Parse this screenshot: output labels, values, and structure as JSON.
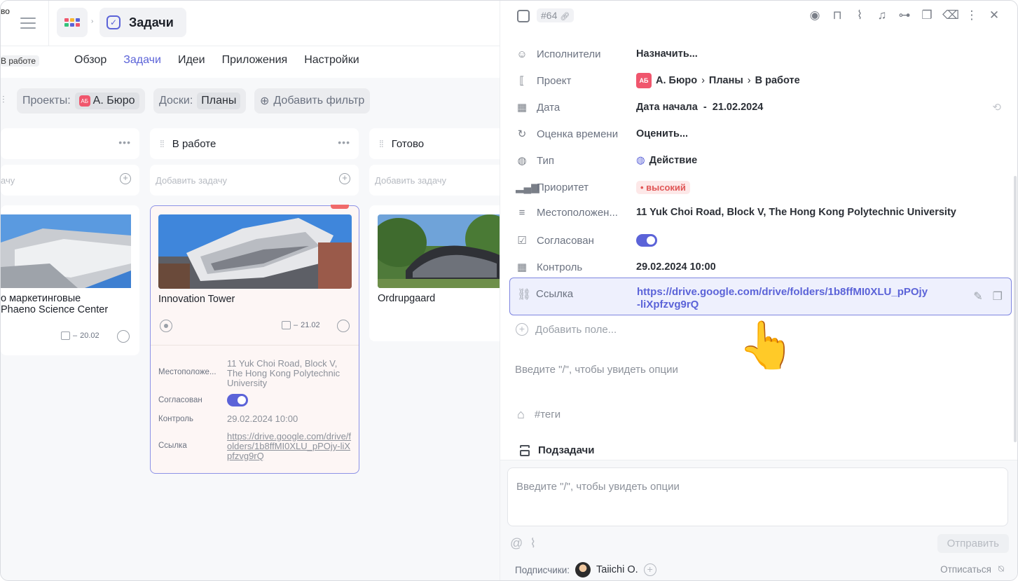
{
  "topbar": {
    "corner_text": "во",
    "section_title": "Задачи",
    "status_chip": "В работе"
  },
  "nav": {
    "tabs": [
      "Обзор",
      "Задачи",
      "Идеи",
      "Приложения",
      "Настройки"
    ],
    "active": "Задачи"
  },
  "filters": {
    "projects_label": "Проекты:",
    "projects_value": "А. Бюро",
    "projects_badge": "АБ",
    "boards_label": "Доски:",
    "boards_value": "Планы",
    "add_filter": "Добавить фильтр"
  },
  "board": {
    "columns": [
      {
        "title": "",
        "add_placeholder": "ачу"
      },
      {
        "title": "В работе",
        "add_placeholder": "Добавить задачу"
      },
      {
        "title": "Готово",
        "add_placeholder": "Добавить задачу"
      }
    ],
    "cards": [
      {
        "title_line1": "о маркетинговые",
        "title_line2": "Phaeno Science Center",
        "date": "20.02"
      },
      {
        "title": "Innovation Tower",
        "date": "21.02",
        "props": {
          "location_label": "Местоположе...",
          "location_value": "11 Yuk Choi Road, Block V, The Hong Kong Polytechnic University",
          "approved_label": "Согласован",
          "control_label": "Контроль",
          "control_value": "29.02.2024 10:00",
          "link_label": "Ссылка",
          "link_value": "https://drive.google.com/drive/folders/1b8ffMI0XLU_pPOjy-liXpfzvg9rQ"
        }
      },
      {
        "title": "Ordrupgaard"
      }
    ],
    "date_prefix": "–"
  },
  "panel": {
    "task_id": "#64",
    "rows": {
      "assignees": {
        "label": "Исполнители",
        "value": "Назначить..."
      },
      "project": {
        "label": "Проект",
        "badge": "АБ",
        "path": [
          "А. Бюро",
          "Планы",
          "В работе"
        ]
      },
      "date": {
        "label": "Дата",
        "value": "Дата начала  -  21.02.2024"
      },
      "estimate": {
        "label": "Оценка времени",
        "value": "Оценить..."
      },
      "type": {
        "label": "Тип",
        "value": "Действие"
      },
      "priority": {
        "label": "Приоритет",
        "value": "• высокий"
      },
      "location": {
        "label": "Местоположен...",
        "value": "11 Yuk Choi Road, Block V, The Hong Kong Polytechnic University"
      },
      "approved": {
        "label": "Согласован"
      },
      "control": {
        "label": "Контроль",
        "value": "29.02.2024 10:00"
      },
      "link": {
        "label": "Ссылка",
        "value": "https://drive.google.com/drive/folders/1b8ffMI0XLU_pPOjy-liXpfzvg9rQ"
      }
    },
    "add_field": "Добавить поле...",
    "description_placeholder": "Введите \"/\", чтобы увидеть опции",
    "tags": "#теги",
    "subtasks": "Подзадачи",
    "comment_placeholder": "Введите \"/\", чтобы увидеть опции",
    "send": "Отправить",
    "subscribers_label": "Подписчики:",
    "subscriber_name": "Taiichi O.",
    "unsubscribe": "Отписаться"
  },
  "colors": {
    "accent": "#5b63d8",
    "priority_red": "#e05656",
    "link_highlight_bg": "#eef0fd"
  }
}
